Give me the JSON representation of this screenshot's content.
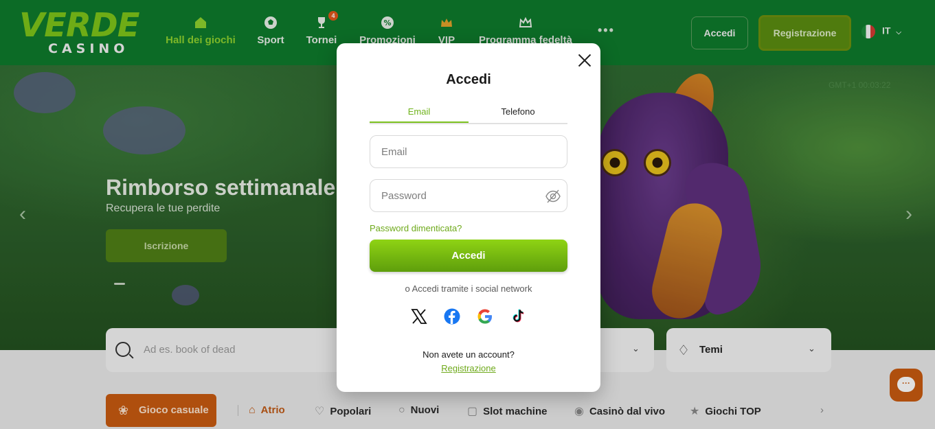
{
  "header": {
    "logo_top": "VERDE",
    "logo_bottom": "CASINO",
    "nav": [
      {
        "label": "Hall dei giochi",
        "icon": "home-icon"
      },
      {
        "label": "Sport",
        "icon": "soccer-ball-icon"
      },
      {
        "label": "Tornei",
        "icon": "trophy-icon",
        "badge": "4"
      },
      {
        "label": "Promozioni",
        "icon": "percent-badge-icon"
      },
      {
        "label": "VIP",
        "icon": "crown-icon"
      },
      {
        "label": "Programma fedeltà",
        "icon": "loyalty-crown-icon"
      }
    ],
    "more": "•••",
    "login_label": "Accedi",
    "register_label": "Registrazione",
    "language": "IT"
  },
  "banner": {
    "title": "Rimborso settimanale",
    "subtitle": "Recupera le tue perdite",
    "cta": "Iscrizione",
    "timer": "GMT+1 00:03:22"
  },
  "search": {
    "placeholder": "Ad es. book of dead",
    "themes_label": "Temi"
  },
  "categories": {
    "casual_label": "Gioco casuale",
    "items": [
      {
        "label": "Atrio",
        "icon": "house-icon"
      },
      {
        "label": "Popolari",
        "icon": "heart-icon"
      },
      {
        "label": "Nuovi",
        "icon": "new-icon"
      },
      {
        "label": "Slot machine",
        "icon": "slot-machine-icon"
      },
      {
        "label": "Casinò dal vivo",
        "icon": "live-casino-icon"
      },
      {
        "label": "Giochi TOP",
        "icon": "top-games-icon"
      }
    ]
  },
  "modal": {
    "title": "Accedi",
    "tabs": [
      "Email",
      "Telefono"
    ],
    "email_placeholder": "Email",
    "password_placeholder": "Password",
    "forgot": "Password dimenticata?",
    "submit": "Accedi",
    "social_label": "o Accedi tramite i social network",
    "social": [
      "x-icon",
      "facebook-icon",
      "google-icon",
      "tiktok-icon"
    ],
    "no_account": "Non avete un account?",
    "register_link": "Registrazione"
  },
  "colors": {
    "brand_green": "#7bc11e",
    "header_green": "#0e7a2c",
    "accent_orange": "#c85a10"
  }
}
